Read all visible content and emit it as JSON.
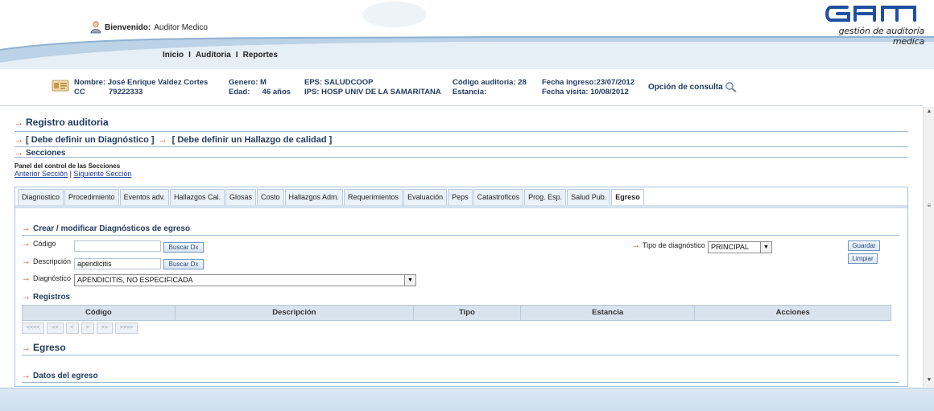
{
  "header": {
    "welcome_label": "Bienvenido:",
    "welcome_user": "Auditor Medico",
    "logo_text": "GAM",
    "logo_tagline": "gestión de auditoría medica",
    "nav": [
      "Inicio",
      "Auditoria",
      "Reportes"
    ],
    "nav_separator": "I"
  },
  "patient": {
    "nombre_line": "Nombre: José Enrique Valdez Cortes",
    "id_type": "CC",
    "id_number": "79222333",
    "genero_line": "Genero: M",
    "edad_label": "Edad:",
    "edad_value": "46 años",
    "eps_line": "EPS:  SALUDCOOP",
    "ips_line": "IPS:  HOSP UNIV DE LA SAMARITANA",
    "codigo_line": "Código auditoria:  28",
    "estancia_line": "Estancia:",
    "fecha_ingreso_line": "Fecha ingreso:23/07/2012",
    "fecha_visita_line": "Fecha visita:   10/08/2012",
    "consulta_label": "Opción de consulta"
  },
  "content": {
    "registro_title": "Registro auditoria",
    "diag_link": "[ Debe definir un Diagnóstico ]",
    "hallazgo_link": "[ Debe definir un Hallazgo de calidad ]",
    "secciones_title": "Secciones",
    "panel_label": "Panel del control de las Secciones",
    "prev_section": "Anterior Sección",
    "next_section": "Siguiente Sección",
    "link_separator": "|",
    "tabs": [
      {
        "label": "Diagnostico"
      },
      {
        "label": "Procedimiento"
      },
      {
        "label": "Eventos adv."
      },
      {
        "label": "Hallazgos Cal."
      },
      {
        "label": "Glosas"
      },
      {
        "label": "Costo"
      },
      {
        "label": "Hallazgos Adm."
      },
      {
        "label": "Requerimientos"
      },
      {
        "label": "Evaluación"
      },
      {
        "label": "Peps"
      },
      {
        "label": "Catastroficos"
      },
      {
        "label": "Prog. Esp."
      },
      {
        "label": "Salud Pub."
      },
      {
        "label": "Egreso",
        "active": true
      }
    ],
    "form": {
      "title": "Crear / modificar Diagnósticos de egreso",
      "codigo_label": "Código",
      "codigo_value": "",
      "descripcion_label": "Descripción",
      "descripcion_value": "apendicitis",
      "buscar_label": "Buscar Dx",
      "diagnostico_label": "Diagnóstico",
      "diagnostico_value": "APENDICITIS, NO ESPECIFICADA",
      "tipo_label": "Tipo de diagnóstico",
      "tipo_value": "PRINCIPAL",
      "guardar_label": "Guardar",
      "limpiar_label": "Limpiar"
    },
    "registros": {
      "title": "Registros",
      "columns": [
        "Código",
        "Descripción",
        "Tipo",
        "Estancia",
        "Acciones"
      ],
      "pager": [
        "<<<<",
        "<<",
        "<",
        ">",
        ">>",
        ">>>>"
      ]
    },
    "egreso_title": "Egreso",
    "datos_title": "Datos del egreso"
  },
  "colors": {
    "accent_arrow": "#e34a1c",
    "title_blue": "#1f3a5f",
    "header_swoosh": "#9ab8d6",
    "tab_bg": "#eaf1f8"
  }
}
